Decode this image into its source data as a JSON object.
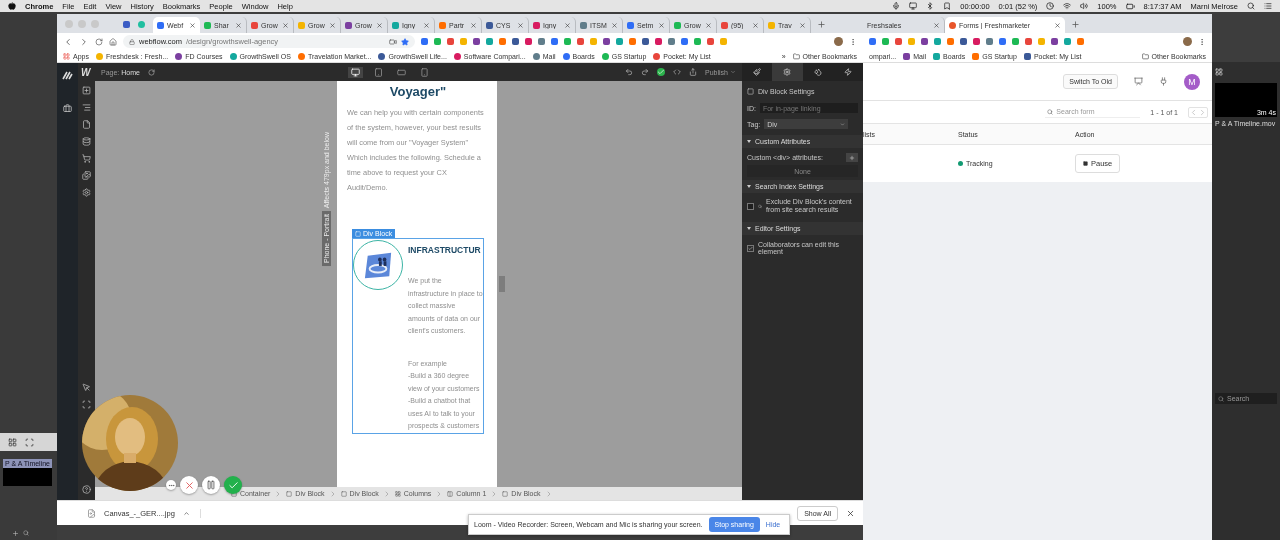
{
  "menubar": {
    "app": "Chrome",
    "menus": [
      "File",
      "Edit",
      "View",
      "History",
      "Bookmarks",
      "People",
      "Window",
      "Help"
    ],
    "timer": "00:00:00",
    "battery_timer": "0:01 (52 %)",
    "battery": "100%",
    "clock": "8:17:37 AM",
    "user": "Marni Melrose"
  },
  "left_app": {
    "clip": "P & A Timeline"
  },
  "back_window": {
    "tabs": [
      {
        "label": "Freshsales",
        "selected": false
      },
      {
        "label": "Forms | Freshmarketer",
        "selected": true
      }
    ],
    "bookmarks": [
      "ompari...",
      "Mail",
      "Boards",
      "GS Startup",
      "Pocket: My List"
    ],
    "other_bookmarks": "Other Bookmarks",
    "switch_button": "Switch To Old",
    "avatar": "M",
    "search": {
      "placeholder": "Search form"
    },
    "pagination": "1 - 1 of 1",
    "columns": [
      "lists",
      "Status",
      "Action"
    ],
    "row": {
      "status": "Tracking",
      "action": "Pause"
    }
  },
  "front_window": {
    "tabs": [
      {
        "label": "Webf",
        "selected": true
      },
      {
        "label": "Shar",
        "selected": false
      },
      {
        "label": "Grow",
        "selected": false
      },
      {
        "label": "Grow",
        "selected": false
      },
      {
        "label": "Grow",
        "selected": false
      },
      {
        "label": "Igny",
        "selected": false
      },
      {
        "label": "Partr",
        "selected": false
      },
      {
        "label": "CYS",
        "selected": false
      },
      {
        "label": "Igny",
        "selected": false
      },
      {
        "label": "ITSM",
        "selected": false
      },
      {
        "label": "Setm",
        "selected": false
      },
      {
        "label": "Grow",
        "selected": false
      },
      {
        "label": "(95)",
        "selected": false
      },
      {
        "label": "Trav",
        "selected": false
      }
    ],
    "url": {
      "host": "webflow.com",
      "path": "/design/growthswell-agency"
    },
    "bookmarks": [
      "Apps",
      "Freshdesk : Fresh...",
      "FD Courses",
      "GrowthSwell OS",
      "Travelation Market...",
      "GrowthSwell Life...",
      "Software Compari...",
      "Mail",
      "Boards",
      "GS Startup",
      "Pocket: My List"
    ],
    "more_bookmarks": "»",
    "other_bookmarks": "Other Bookmarks",
    "download": {
      "file": "Canvas_-_GER....jpg",
      "show_all": "Show All"
    }
  },
  "designer": {
    "logo": "W",
    "page_label": "Page:",
    "page": "Home",
    "publish": "Publish",
    "devices": [
      {
        "selected": true
      },
      {
        "selected": false
      },
      {
        "selected": false
      },
      {
        "selected": false
      }
    ],
    "panel_tabs": [
      {
        "selected": false
      },
      {
        "selected": true
      },
      {
        "selected": false
      },
      {
        "selected": false
      }
    ],
    "breakpoint_note": "Affects 479px and below",
    "breakpoint": "Phone - Portrait",
    "heading": "Voyager\"",
    "intro": "We can help you with certain components of the system, however, your best results will come from our \"Voyager System\" Which includes the following. Schedule a time above to request your CX Audit/Demo.",
    "selection_label": "Div Block",
    "card_title": "INFRASTRUCTUR",
    "card_paragraphs": [
      "We put the infrastructure in place to collect massive amounts of data on our client's customers.",
      "For example\n-Build a 360 degree view of your customers\n-Build a chatbot that uses AI to talk to your prospects & customers"
    ],
    "breadcrumbs": [
      "Container",
      "Div Block",
      "Div Block",
      "Columns",
      "Column 1",
      "Div Block"
    ],
    "settings": {
      "title": "Div Block Settings",
      "id_label": "ID:",
      "id_placeholder": "For in-page linking",
      "tag_label": "Tag:",
      "tag": "Div",
      "sections": [
        {
          "title": "Custom Attributes",
          "expanded": true
        },
        {
          "title": "Search Index Settings",
          "expanded": true
        },
        {
          "title": "Editor Settings",
          "expanded": true
        }
      ],
      "attributes_label": "Custom <div> attributes:",
      "attributes_empty": "None",
      "exclude": {
        "label": "Exclude Div Block's content from site search results",
        "checked": false
      },
      "collaborators": {
        "label": "Collaborators can edit this element",
        "checked": true
      }
    }
  },
  "right_app": {
    "duration": "3m 4s",
    "file": "P & A Timeline.mov",
    "search": {
      "placeholder": "Search"
    }
  },
  "recorder": {
    "controls": [
      {
        "kind": "more"
      },
      {
        "kind": "cancel"
      },
      {
        "kind": "pause"
      },
      {
        "kind": "finish"
      }
    ]
  },
  "loom_notice": {
    "text": "Loom - Video Recorder: Screen, Webcam and Mic is sharing your screen.",
    "stop": "Stop sharing",
    "hide": "Hide"
  }
}
